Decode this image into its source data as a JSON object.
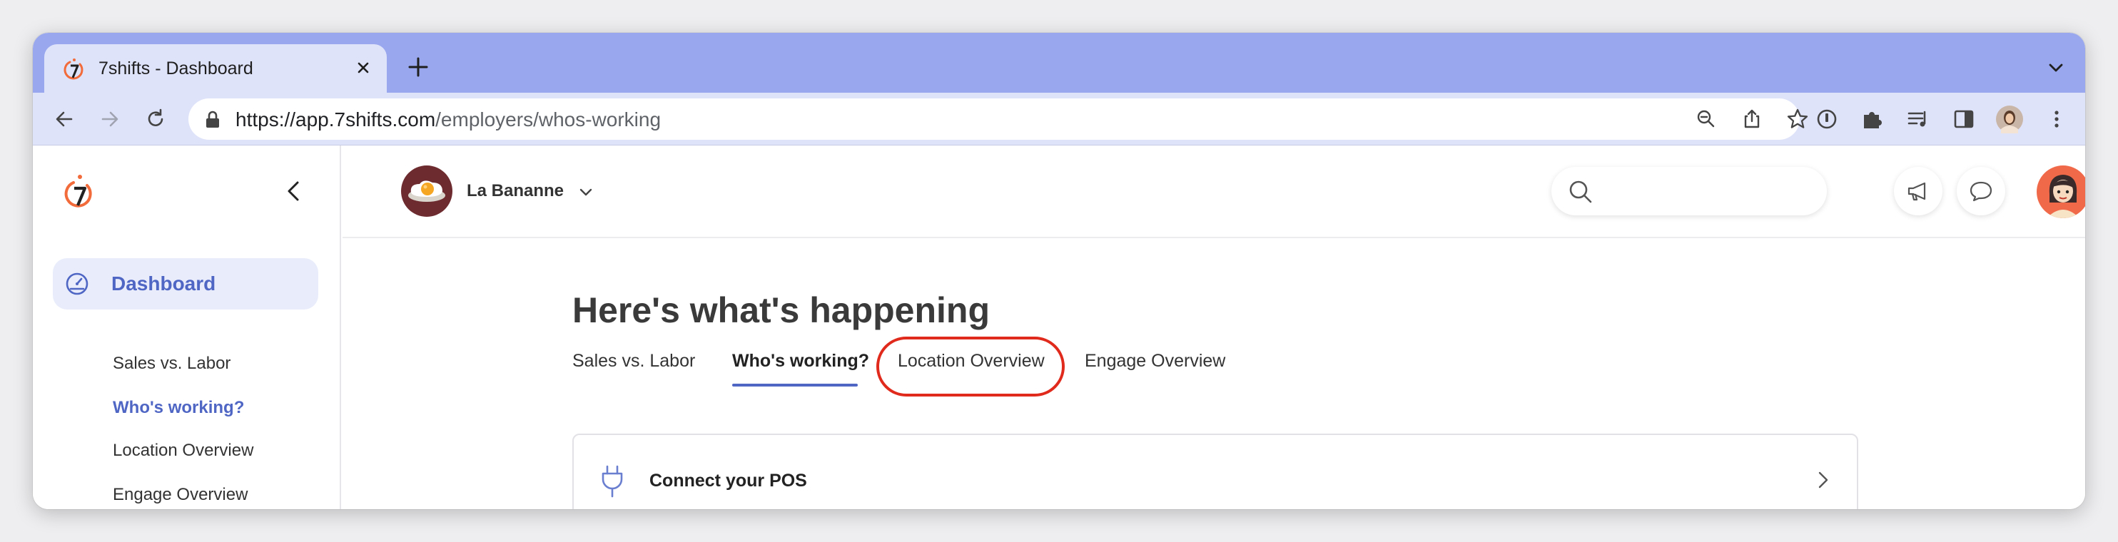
{
  "browser": {
    "tab_title": "7shifts - Dashboard",
    "url_host": "https://app.7shifts.com",
    "url_path": "/employers/whos-working"
  },
  "header": {
    "location_name": "La Bananne"
  },
  "sidebar": {
    "dashboard_label": "Dashboard",
    "items": [
      {
        "label": "Sales vs. Labor",
        "active": false
      },
      {
        "label": "Who's working?",
        "active": true
      },
      {
        "label": "Location Overview",
        "active": false
      },
      {
        "label": "Engage Overview",
        "active": false
      }
    ]
  },
  "main": {
    "headline": "Here's what's happening",
    "tabs": [
      {
        "label": "Sales vs. Labor",
        "active": false
      },
      {
        "label": "Who's working?",
        "active": true
      },
      {
        "label": "Location Overview",
        "active": false,
        "highlighted": true
      },
      {
        "label": "Engage Overview",
        "active": false
      }
    ],
    "card_title": "Connect your POS"
  },
  "colors": {
    "accent": "#4f66c4",
    "brand_orange": "#f26b3a",
    "highlight_ring": "#e02a1c",
    "tabstrip": "#99a8ee"
  }
}
